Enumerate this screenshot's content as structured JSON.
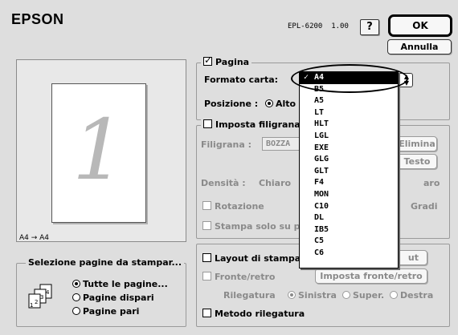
{
  "header": {
    "brand": "EPSON",
    "model": "EPL-6200",
    "version": "1.00",
    "help_label": "?",
    "ok_label": "OK",
    "cancel_label": "Annulla"
  },
  "preview": {
    "page_number": "1",
    "paper_mapping": "A4 → A4"
  },
  "pagina": {
    "label": "Pagina",
    "checked": true,
    "formato_label": "Formato carta:",
    "formato_value": "A4",
    "posizione_label": "Posizione :",
    "posizione_option": "Alto"
  },
  "paper_menu": {
    "items": [
      "A4",
      "B5",
      "A5",
      "LT",
      "HLT",
      "LGL",
      "EXE",
      "GLG",
      "GLT",
      "F4",
      "MON",
      "C10",
      "DL",
      "IB5",
      "C5",
      "C6"
    ],
    "selected": "A4",
    "check_mark": "✓"
  },
  "filigrana": {
    "label": "Imposta filigrana",
    "checked": false,
    "filigrana_label": "Filigrana :",
    "filigrana_value": "BOZZA",
    "elimina_label": "Elimina",
    "testo_label": "Testo",
    "densita_label": "Densità :",
    "chiaro_label": "Chiaro",
    "scuro_label": "aro",
    "rotazione_label": "Rotazione",
    "gradi_label": "Gradi",
    "stampa_label": "Stampa solo su p"
  },
  "layout": {
    "label": "Layout di stampa",
    "layout_button_fragment": "ut",
    "fronte_retro_label": "Fronte/retro",
    "imposta_fronte_retro_label": "Imposta fronte/retro",
    "rilegatura_label": "Rilegatura",
    "rilegatura_options": [
      "Sinistra",
      "Super.",
      "Destra"
    ],
    "rilegatura_selected": "Sinistra",
    "metodo_label": "Metodo rilegatura"
  },
  "selezione": {
    "title": "Selezione pagine da stampar...",
    "options": [
      "Tutte le pagine...",
      "Pagine dispari",
      "Pagine pari"
    ],
    "selected": "Tutte le pagine..."
  }
}
